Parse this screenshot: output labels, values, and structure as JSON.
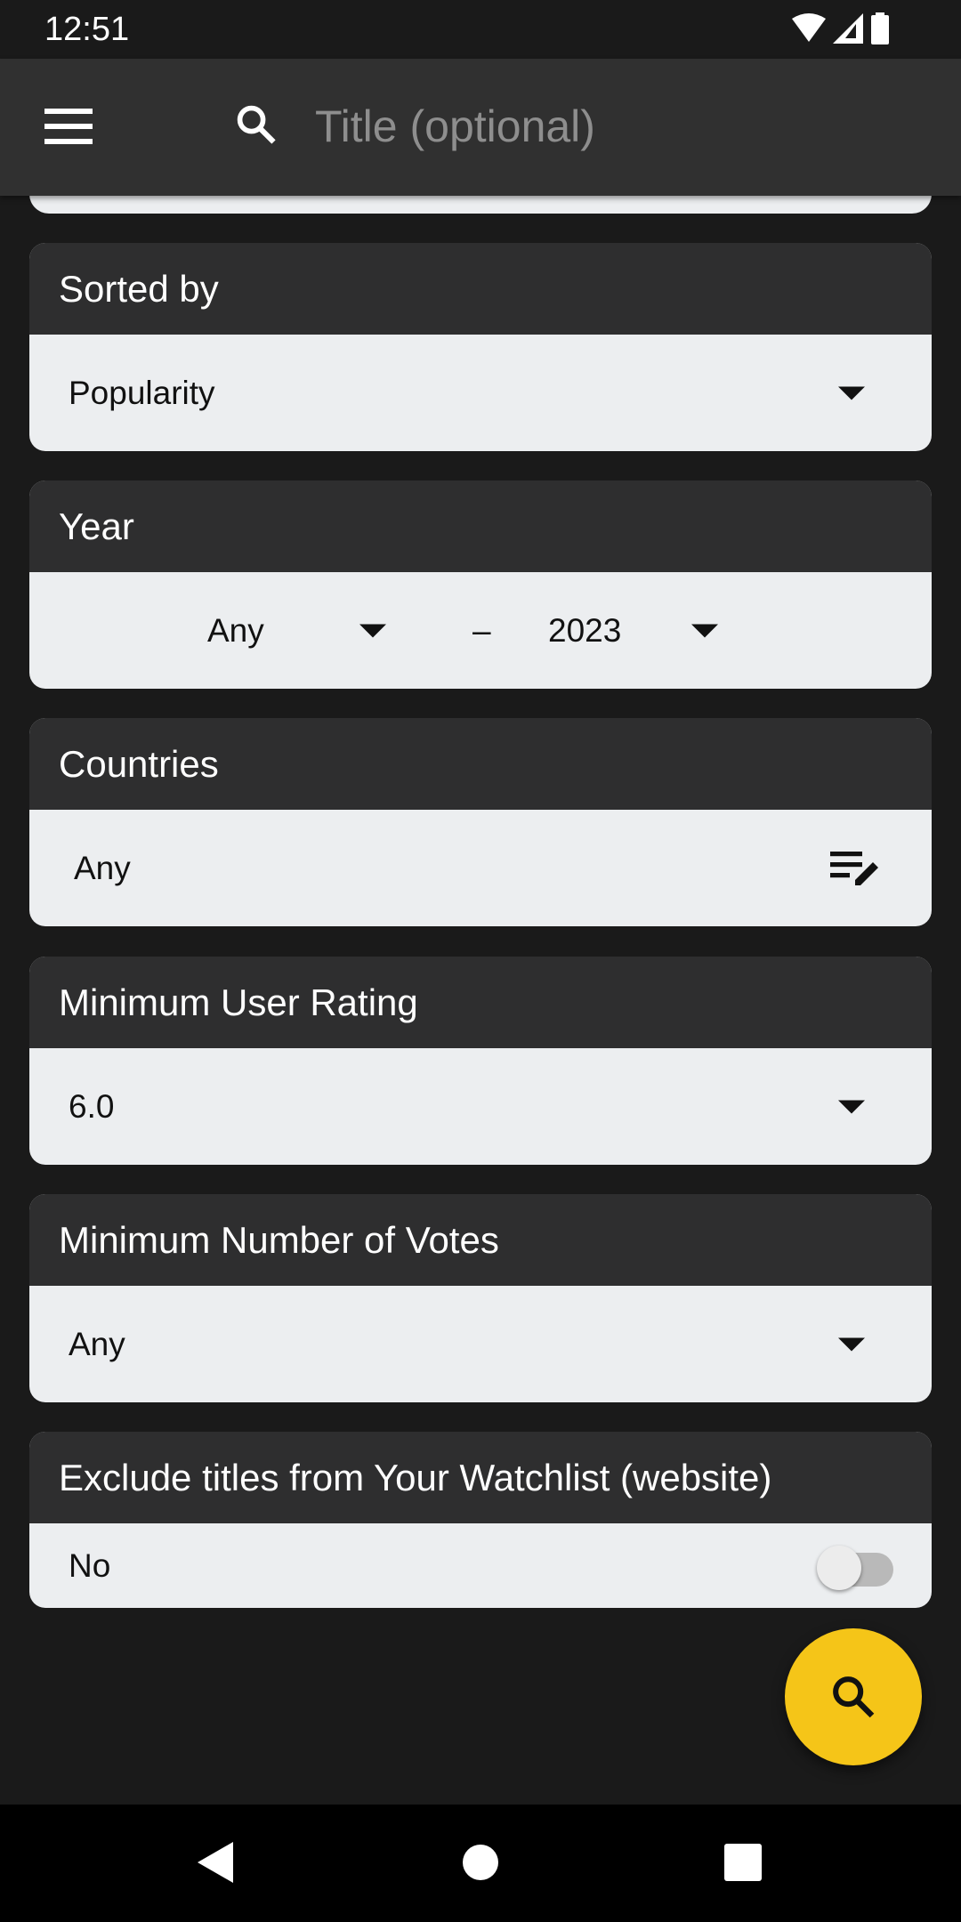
{
  "status_bar": {
    "time": "12:51",
    "icons": [
      "wifi-icon",
      "signal-icon",
      "battery-icon"
    ]
  },
  "app_bar": {
    "menu_icon": "menu-icon",
    "search_icon": "search-icon",
    "title_placeholder": "Title (optional)",
    "title_value": ""
  },
  "filters": {
    "sorted_by": {
      "label": "Sorted by",
      "value": "Popularity"
    },
    "year": {
      "label": "Year",
      "from": "Any",
      "separator": "–",
      "to": "2023"
    },
    "countries": {
      "label": "Countries",
      "value": "Any",
      "icon": "edit-list-icon"
    },
    "min_rating": {
      "label": "Minimum User Rating",
      "value": "6.0"
    },
    "min_votes": {
      "label": "Minimum Number of Votes",
      "value": "Any"
    },
    "exclude_watchlist": {
      "label": "Exclude titles from Your Watchlist (website)",
      "value": "No",
      "toggle_on": false
    }
  },
  "fab": {
    "icon": "search-icon",
    "color": "#f5c518"
  },
  "nav_bar": {
    "icons": [
      "back-icon",
      "home-icon",
      "recents-icon"
    ]
  }
}
